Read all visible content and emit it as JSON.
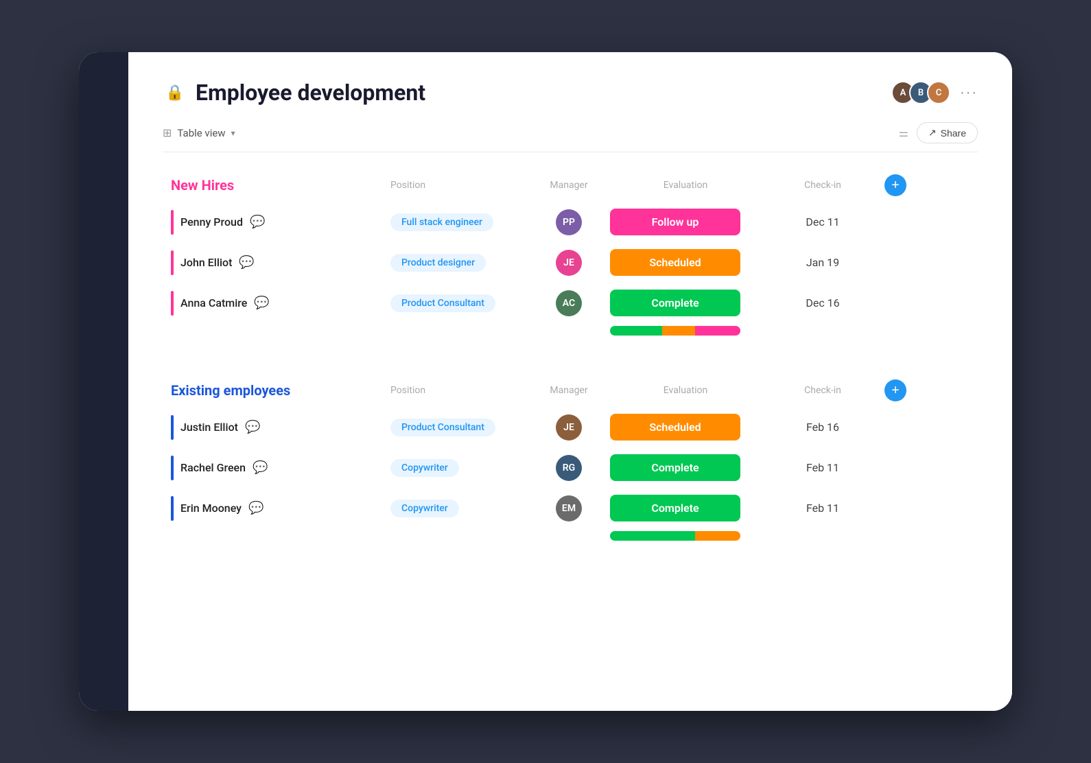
{
  "page": {
    "title": "Employee development",
    "icon": "🔒"
  },
  "header": {
    "more_label": "···",
    "share_label": "Share"
  },
  "toolbar": {
    "view_label": "Table view"
  },
  "new_hires": {
    "section_title": "New Hires",
    "col_position": "Position",
    "col_manager": "Manager",
    "col_evaluation": "Evaluation",
    "col_checkin": "Check-in",
    "rows": [
      {
        "name": "Penny Proud",
        "position": "Full stack engineer",
        "manager_initials": "PP",
        "manager_color": "av-penny",
        "evaluation": "Follow up",
        "eval_class": "eval-followup",
        "checkin": "Dec 11"
      },
      {
        "name": "John Elliot",
        "position": "Product designer",
        "manager_initials": "JE",
        "manager_color": "av-john",
        "evaluation": "Scheduled",
        "eval_class": "eval-scheduled",
        "checkin": "Jan 19"
      },
      {
        "name": "Anna Catmire",
        "position": "Product Consultant",
        "manager_initials": "AC",
        "manager_color": "av-anna",
        "evaluation": "Complete",
        "eval_class": "eval-complete",
        "checkin": "Dec 16"
      }
    ],
    "progress": [
      {
        "green": 40,
        "orange": 25,
        "pink": 35
      }
    ]
  },
  "existing_employees": {
    "section_title": "Existing employees",
    "col_position": "Position",
    "col_manager": "Manager",
    "col_evaluation": "Evaluation",
    "col_checkin": "Check-in",
    "rows": [
      {
        "name": "Justin Elliot",
        "position": "Product Consultant",
        "manager_initials": "JE",
        "manager_color": "av-justin",
        "evaluation": "Scheduled",
        "eval_class": "eval-scheduled",
        "checkin": "Feb 16"
      },
      {
        "name": "Rachel Green",
        "position": "Copywriter",
        "manager_initials": "RG",
        "manager_color": "av-rachel",
        "evaluation": "Complete",
        "eval_class": "eval-complete",
        "checkin": "Feb 11"
      },
      {
        "name": "Erin Mooney",
        "position": "Copywriter",
        "manager_initials": "EM",
        "manager_color": "av-erin",
        "evaluation": "Complete",
        "eval_class": "eval-complete",
        "checkin": "Feb 11"
      }
    ],
    "progress": [
      {
        "green": 55,
        "orange": 25,
        "pink": 0
      }
    ]
  }
}
